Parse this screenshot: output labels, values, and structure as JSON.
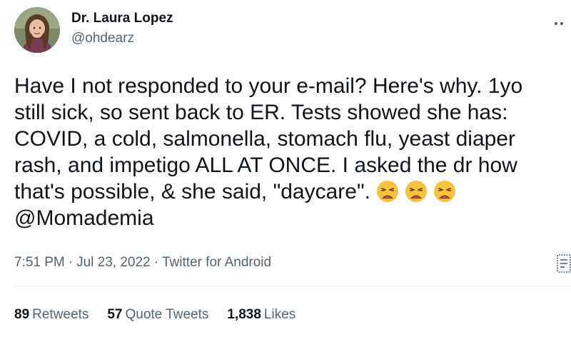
{
  "author": {
    "display_name": "Dr. Laura Lopez",
    "handle": "@ohdearz"
  },
  "tweet": {
    "text": "Have I not responded to your e-mail? Here's why. 1yo\nstill sick, so sent back to ER. Tests showed she has:\nCOVID, a cold, salmonella, stomach flu, yeast diaper\nrash, and impetigo ALL AT ONCE. I asked the dr how\nthat's possible, & she said, \"daycare\".",
    "emojis": [
      "weary-face-emoji",
      "weary-face-emoji",
      "weary-face-emoji"
    ],
    "mention": "@Momademia"
  },
  "meta": {
    "time": "7:51 PM",
    "separator": "·",
    "date": "Jul 23, 2022",
    "source": "Twitter for Android"
  },
  "stats": {
    "retweets_count": "89",
    "retweets_label": "Retweets",
    "quote_tweets_count": "57",
    "quote_tweets_label": "Quote Tweets",
    "likes_count": "1,838",
    "likes_label": "Likes"
  },
  "icons": {
    "more": "more-options-icon",
    "analytics": "analytics-icon"
  },
  "colors": {
    "text": "#0f1419",
    "secondary": "#536471",
    "divider": "#eff3f4",
    "emoji_face": "#f9c23c"
  }
}
